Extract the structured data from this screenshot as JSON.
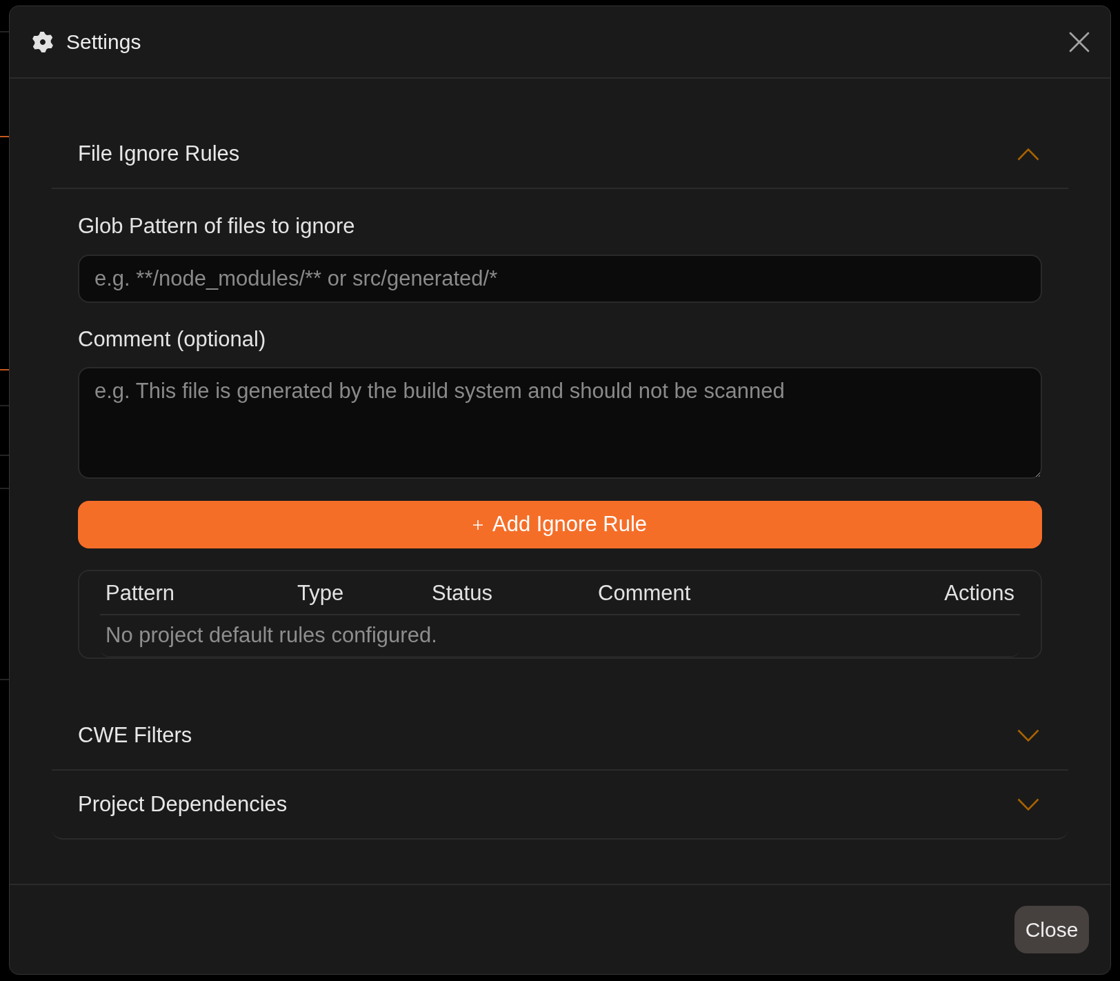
{
  "dialog": {
    "title": "Settings",
    "close_button": "Close"
  },
  "sections": [
    {
      "title": "File Ignore Rules",
      "expanded": true,
      "fields": [
        {
          "label": "Glob Pattern of files to ignore",
          "kind": "input",
          "placeholder": "e.g. **/node_modules/** or src/generated/*"
        },
        {
          "label": "Comment (optional)",
          "kind": "textarea",
          "placeholder": "e.g. This file is generated by the build system and should not be scanned"
        }
      ],
      "add_button": "Add Ignore Rule",
      "table": {
        "columns": [
          "Pattern",
          "Type",
          "Status",
          "Comment",
          "Actions"
        ],
        "empty_message": "No project default rules configured."
      }
    },
    {
      "title": "CWE Filters",
      "expanded": false
    },
    {
      "title": "Project Dependencies",
      "expanded": false
    }
  ]
}
